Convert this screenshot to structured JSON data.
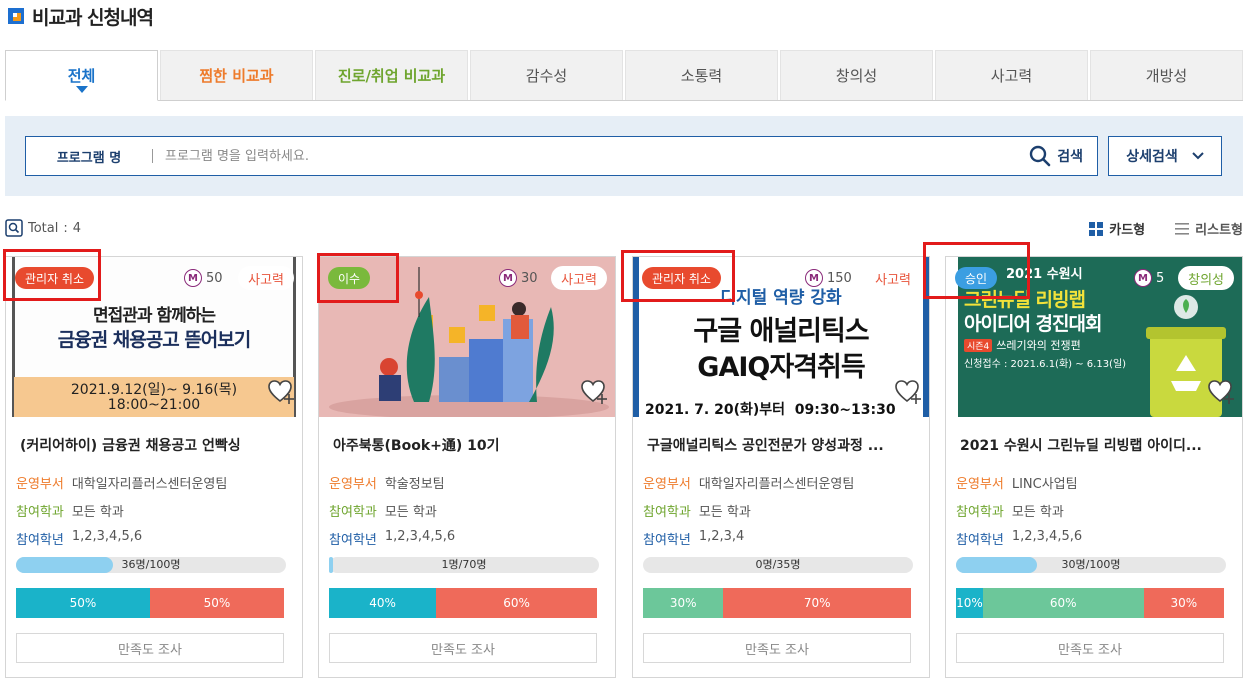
{
  "page": {
    "title": "비교과 신청내역"
  },
  "tabs": [
    {
      "label": "전체",
      "active": true
    },
    {
      "label": "찜한 비교과"
    },
    {
      "label": "진로/취업 비교과"
    },
    {
      "label": "감수성"
    },
    {
      "label": "소통력"
    },
    {
      "label": "창의성"
    },
    {
      "label": "사고력"
    },
    {
      "label": "개방성"
    }
  ],
  "search": {
    "field_label": "프로그램 명",
    "placeholder": "프로그램 명을 입력하세요.",
    "button": "검색",
    "detail_button": "상세검색"
  },
  "total": {
    "label": "Total",
    "separator": ":",
    "count": "4"
  },
  "view": {
    "card": "카드형",
    "list": "리스트형"
  },
  "info_labels": {
    "dept": "운영부서",
    "major": "참여학과",
    "grade": "참여학년"
  },
  "survey_label": "만족도 조사",
  "colors": {
    "teal": "#1ab3c9",
    "coral": "#ef6a5a",
    "green": "#6cc79a",
    "blue": "#1f5ea6",
    "orange": "#ee7b2b"
  },
  "cards": [
    {
      "status": "관리자 취소",
      "mileage": "50",
      "category": "사고력",
      "title": "(커리어하이) 금융권 채용공고 언빡싱",
      "dept": "대학일자리플러스센터운영팀",
      "major": "모든 학과",
      "grade": "1,2,3,4,5,6",
      "progress_text": "36명/100명",
      "progress": 0.36,
      "ratio": [
        {
          "label": "50%",
          "value": 50,
          "color": "teal"
        },
        {
          "label": "50%",
          "value": 50,
          "color": "coral"
        }
      ],
      "thumb": {
        "line1": "면접관과 함께하는",
        "line2": "금융권 채용공고 뜯어보기",
        "line3": "2021.9.12(일)~ 9.16(목)",
        "line4": "18:00~21:00"
      }
    },
    {
      "status": "이수",
      "mileage": "30",
      "category": "사고력",
      "title": "아주북통(Book+通) 10기",
      "dept": "학술정보팀",
      "major": "모든 학과",
      "grade": "1,2,3,4,5,6",
      "progress_text": "1명/70명",
      "progress": 0.0143,
      "ratio": [
        {
          "label": "40%",
          "value": 40,
          "color": "teal"
        },
        {
          "label": "60%",
          "value": 60,
          "color": "coral"
        }
      ]
    },
    {
      "status": "관리자 취소",
      "mileage": "150",
      "category": "사고력",
      "title": "구글애널리틱스 공인전문가 양성과정 ...",
      "dept": "대학일자리플러스센터운영팀",
      "major": "모든 학과",
      "grade": "1,2,3,4",
      "progress_text": "0명/35명",
      "progress": 0,
      "ratio": [
        {
          "label": "30%",
          "value": 30,
          "color": "green"
        },
        {
          "label": "70%",
          "value": 70,
          "color": "coral"
        }
      ],
      "thumb": {
        "line0": "디지털 역량 강화",
        "line1": "구글 애널리틱스",
        "line2": "GAIQ자격취득",
        "line3": "2021. 7. 20(화)부터  09:30~13:30"
      }
    },
    {
      "status": "승인",
      "mileage": "5",
      "category": "창의성",
      "title": "2021 수원시 그린뉴딜 리빙랩 아이디...",
      "dept": "LINC사업팀",
      "major": "모든 학과",
      "grade": "1,2,3,4,5,6",
      "progress_text": "30명/100명",
      "progress": 0.3,
      "ratio": [
        {
          "label": "10%",
          "value": 10,
          "color": "teal"
        },
        {
          "label": "60%",
          "value": 60,
          "color": "green"
        },
        {
          "label": "30%",
          "value": 30,
          "color": "coral"
        }
      ],
      "thumb": {
        "line0": "2021 수원시",
        "line1": "그린뉴딜 리빙랩",
        "line2": "아이디어 경진대회",
        "line3": "쓰레기와의 전쟁편",
        "line3_tag": "시즌4",
        "line4": "신청접수 : 2021.6.1(화) ~ 6.13(일)"
      }
    }
  ]
}
